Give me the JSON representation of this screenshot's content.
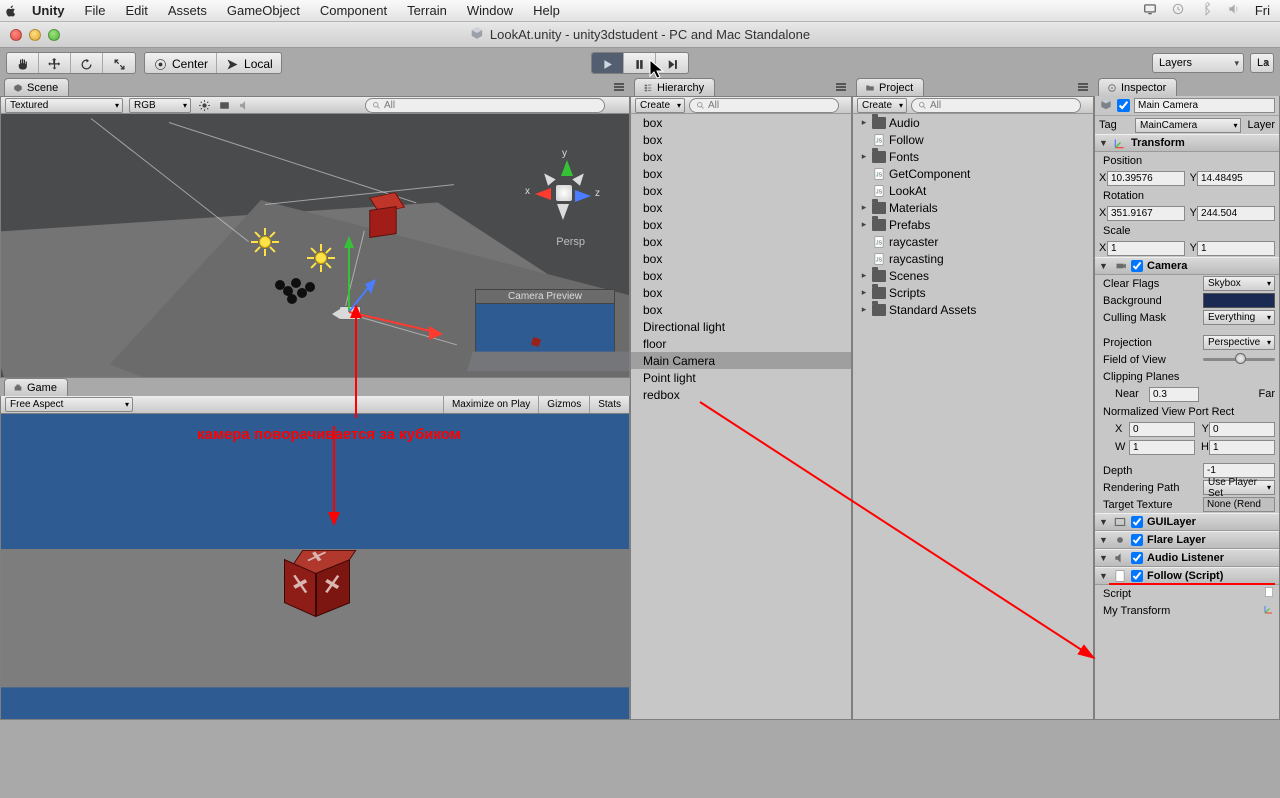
{
  "mac_menu": {
    "app": "Unity",
    "items": [
      "File",
      "Edit",
      "Assets",
      "GameObject",
      "Component",
      "Terrain",
      "Window",
      "Help"
    ],
    "right_day": "Fri"
  },
  "unity_title": "LookAt.unity - unity3dstudent - PC and Mac Standalone",
  "toolbar": {
    "pivot_center": "Center",
    "pivot_local": "Local",
    "layers": "Layers",
    "layout": "La"
  },
  "scene": {
    "tab": "Scene",
    "shade": "Textured",
    "render": "RGB",
    "search_placeholder": "All",
    "persp": "Persp",
    "axes": {
      "x": "x",
      "y": "y",
      "z": "z"
    },
    "cam_preview": "Camera Preview"
  },
  "game": {
    "tab": "Game",
    "aspect": "Free Aspect",
    "max": "Maximize on Play",
    "gizmos": "Gizmos",
    "stats": "Stats"
  },
  "hierarchy": {
    "tab": "Hierarchy",
    "create": "Create",
    "search_placeholder": "All",
    "items": [
      "box",
      "box",
      "box",
      "box",
      "box",
      "box",
      "box",
      "box",
      "box",
      "box",
      "box",
      "box",
      "Directional light",
      "floor",
      "Main Camera",
      "Point light",
      "redbox"
    ],
    "selected": "Main Camera"
  },
  "project": {
    "tab": "Project",
    "create": "Create",
    "search_placeholder": "All",
    "items": [
      {
        "name": "Audio",
        "type": "folder",
        "expand": true
      },
      {
        "name": "Follow",
        "type": "js",
        "expand": false
      },
      {
        "name": "Fonts",
        "type": "folder",
        "expand": true
      },
      {
        "name": "GetComponent",
        "type": "js",
        "expand": false
      },
      {
        "name": "LookAt",
        "type": "js",
        "expand": false
      },
      {
        "name": "Materials",
        "type": "folder",
        "expand": true
      },
      {
        "name": "Prefabs",
        "type": "folder",
        "expand": true
      },
      {
        "name": "raycaster",
        "type": "js",
        "expand": false
      },
      {
        "name": "raycasting",
        "type": "js",
        "expand": false
      },
      {
        "name": "Scenes",
        "type": "folder",
        "expand": true
      },
      {
        "name": "Scripts",
        "type": "folder",
        "expand": true
      },
      {
        "name": "Standard Assets",
        "type": "folder",
        "expand": true
      }
    ]
  },
  "inspector": {
    "tab": "Inspector",
    "go_name": "Main Camera",
    "tag_label": "Tag",
    "tag_value": "MainCamera",
    "layer_label": "Layer",
    "transform": {
      "title": "Transform",
      "pos_label": "Position",
      "px": "10.39576",
      "py": "14.48495",
      "rot_label": "Rotation",
      "rx": "351.9167",
      "ry": "244.504",
      "scale_label": "Scale",
      "sx": "1",
      "sy": "1"
    },
    "camera": {
      "title": "Camera",
      "clear_flags_l": "Clear Flags",
      "clear_flags_v": "Skybox",
      "background_l": "Background",
      "culling_l": "Culling Mask",
      "culling_v": "Everything",
      "projection_l": "Projection",
      "projection_v": "Perspective",
      "fov_l": "Field of View",
      "clip_l": "Clipping Planes",
      "near_l": "Near",
      "near_v": "0.3",
      "far_l": "Far",
      "nvp_l": "Normalized View Port Rect",
      "nx": "0",
      "ny": "0",
      "nw": "1",
      "nh": "1",
      "depth_l": "Depth",
      "depth_v": "-1",
      "rpath_l": "Rendering Path",
      "rpath_v": "Use Player Set",
      "ttex_l": "Target Texture",
      "ttex_v": "None (Rend"
    },
    "components": {
      "guilayer": "GUILayer",
      "flare": "Flare Layer",
      "audio": "Audio Listener",
      "follow": "Follow (Script)",
      "script_l": "Script",
      "mytransform_l": "My Transform"
    }
  },
  "annotation": "камера поворачивается за кубиком"
}
